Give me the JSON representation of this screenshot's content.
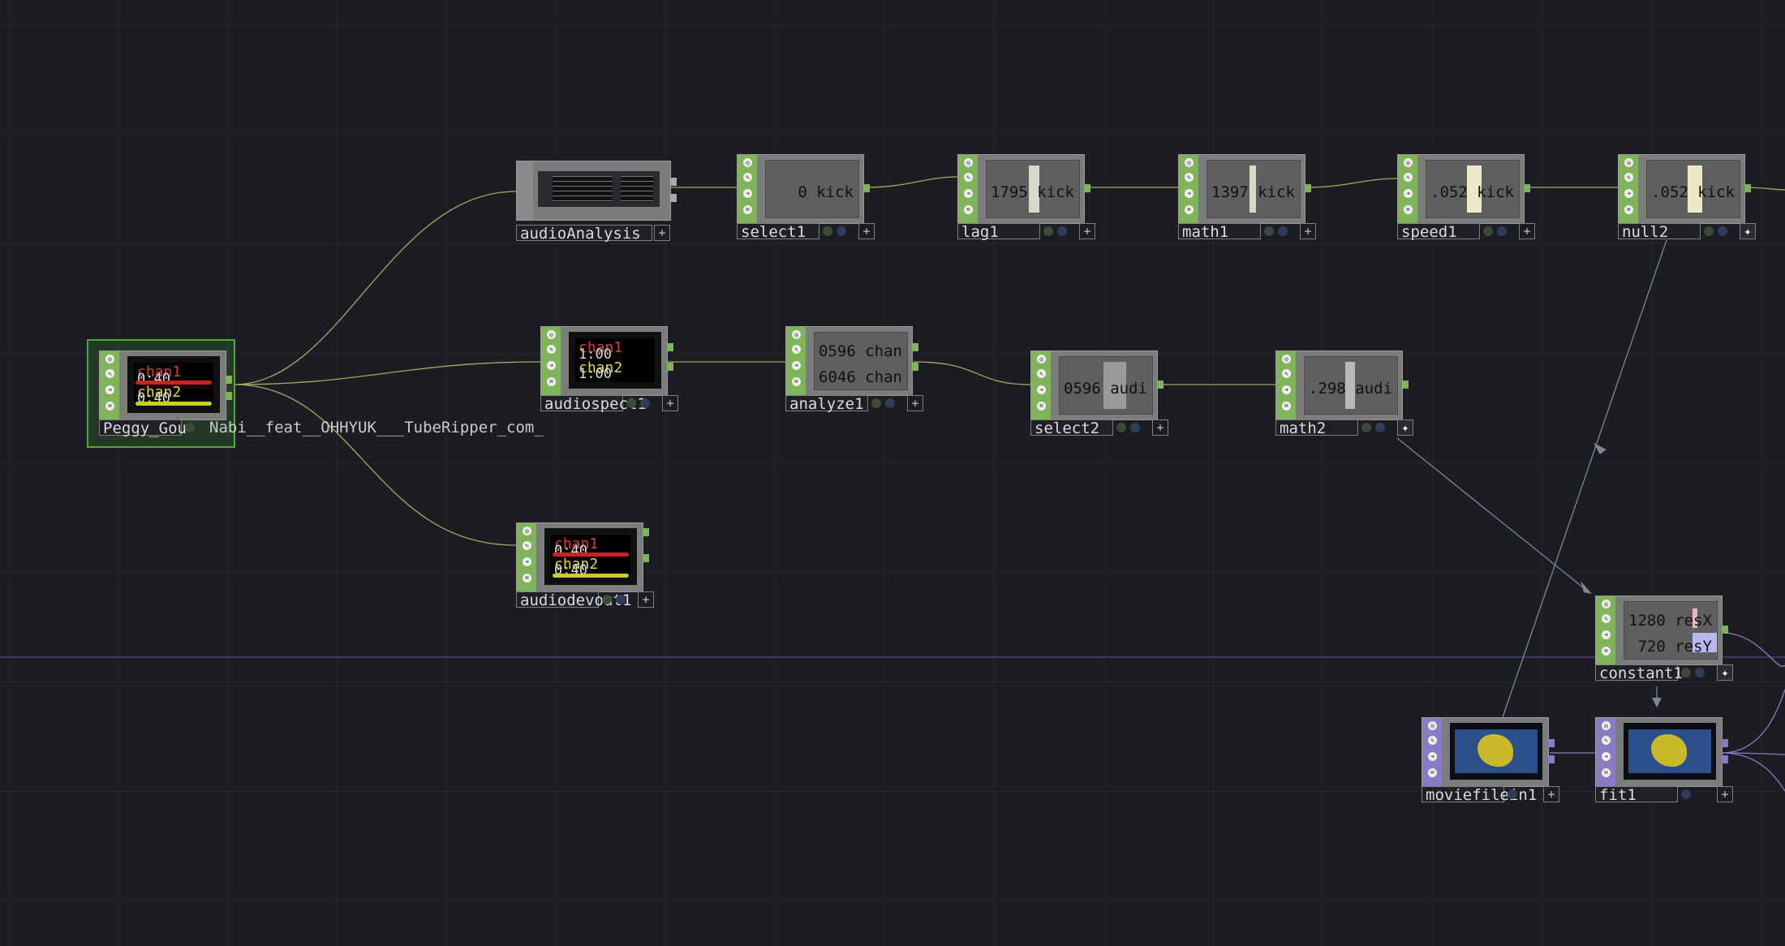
{
  "colors": {
    "background": "#1c1d22",
    "chop": "#7fb45a",
    "top": "#8b7bc4",
    "wire": "#b7c46c",
    "link": "#7c879a"
  },
  "filename_label": "Nabi__feat__OHHYUK___TubeRipper_com_",
  "nodes": {
    "peggy": {
      "name": "Peggy_Gou",
      "scope": [
        "chan1",
        "0:40",
        "chan2",
        "0:40"
      ]
    },
    "audioAnalysis": {
      "name": "audioAnalysis"
    },
    "select1": {
      "name": "select1",
      "value": "0",
      "chan": "kick"
    },
    "lag1": {
      "name": "lag1",
      "value": "1795",
      "chan": "kick"
    },
    "math1": {
      "name": "math1",
      "value": "1397",
      "chan": "kick"
    },
    "speed1": {
      "name": "speed1",
      "value": ".052",
      "chan": "kick"
    },
    "null2": {
      "name": "null2",
      "value": ".052",
      "chan": "kick"
    },
    "audiospect1": {
      "name": "audiospect1",
      "scope": [
        "chan1",
        "1:00",
        "chan2",
        "1:00"
      ]
    },
    "analyze1": {
      "name": "analyze1",
      "value1": "0596",
      "chan1": "chan",
      "value2": "6046",
      "chan2": "chan"
    },
    "select2": {
      "name": "select2",
      "value": "0596",
      "chan": "audi"
    },
    "math2": {
      "name": "math2",
      "value": ".298",
      "chan": "audi"
    },
    "audiodevout1": {
      "name": "audiodevout1",
      "scope": [
        "chan1",
        "0:40",
        "chan2",
        "0:40"
      ]
    },
    "constant1": {
      "name": "constant1",
      "value1": "1280",
      "chan1": "resX",
      "value2": "720",
      "chan2": "resY"
    },
    "moviefilein1": {
      "name": "moviefilein1"
    },
    "fit1": {
      "name": "fit1"
    }
  }
}
